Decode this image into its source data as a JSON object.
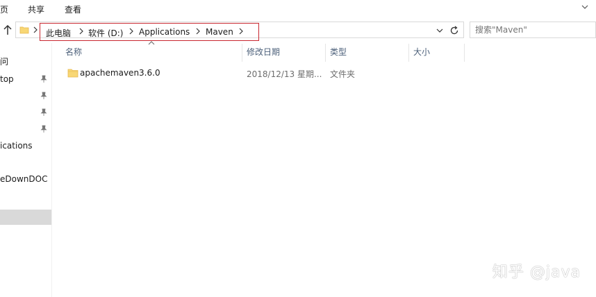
{
  "ribbon": {
    "tabs": [
      "页",
      "共享",
      "查看"
    ]
  },
  "address": {
    "crumbs": [
      "此电脑",
      "软件 (D:)",
      "Applications",
      "Maven"
    ],
    "highlight_color": "#c8262e"
  },
  "search": {
    "placeholder": "搜索\"Maven\""
  },
  "nav": {
    "items": [
      {
        "label": "问",
        "pinned": false
      },
      {
        "label": "top",
        "pinned": true
      },
      {
        "label": "",
        "pinned": true
      },
      {
        "label": "",
        "pinned": true
      },
      {
        "label": "",
        "pinned": true
      },
      {
        "label": "ications",
        "pinned": false
      },
      {
        "label": "eDownDOC",
        "pinned": false
      }
    ]
  },
  "columns": {
    "name": "名称",
    "modified": "修改日期",
    "type": "类型",
    "size": "大小"
  },
  "files": [
    {
      "name": "apachemaven3.6.0",
      "modified": "2018/12/13 星期...",
      "type": "文件夹",
      "size": ""
    }
  ],
  "watermark": "知乎 @java",
  "colors": {
    "folder_yellow": "#f8d775",
    "folder_dark": "#e6b84f",
    "selected_bg": "#d9d9d9",
    "header_text": "#4c607a"
  }
}
